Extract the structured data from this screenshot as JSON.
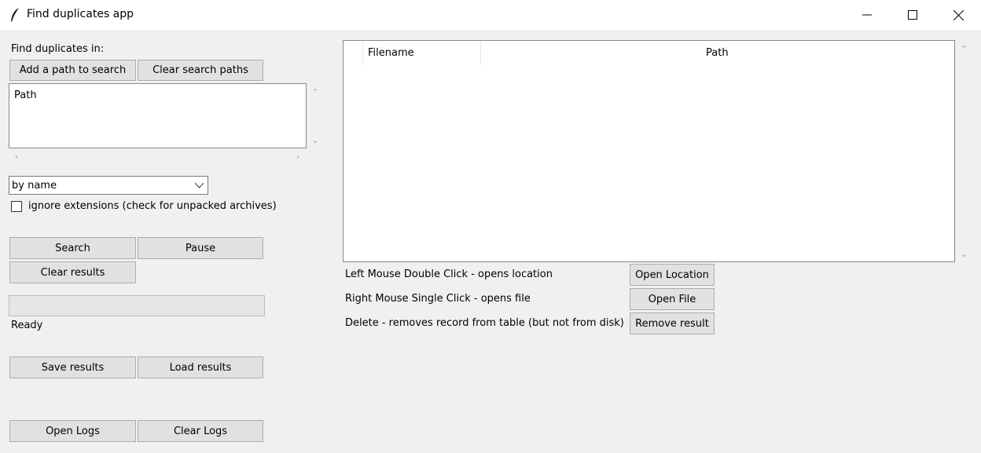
{
  "window": {
    "title": "Find duplicates app",
    "icons": [
      "feather-icon",
      "minimize-icon",
      "maximize-icon",
      "close-icon"
    ]
  },
  "left": {
    "find_in_label": "Find duplicates in:",
    "add_path_label": "Add a path to search",
    "clear_paths_label": "Clear search paths",
    "paths_list": [
      "Path"
    ],
    "mode_value": "by name",
    "ignore_ext_label": "ignore extensions (check for unpacked archives)",
    "ignore_ext_checked": false,
    "search_label": "Search",
    "pause_label": "Pause",
    "clear_results_label": "Clear results",
    "progress": 0,
    "status_text": "Ready",
    "save_results_label": "Save results",
    "load_results_label": "Load results",
    "open_logs_label": "Open Logs",
    "clear_logs_label": "Clear Logs"
  },
  "results": {
    "columns": [
      "Filename",
      "Path"
    ],
    "rows": []
  },
  "help": {
    "double_click_text": "Left Mouse Double Click - opens location",
    "right_click_text": "Right Mouse Single Click - opens file",
    "delete_text": "Delete - removes record from table (but not from disk)",
    "open_location_label": "Open Location",
    "open_file_label": "Open File",
    "remove_result_label": "Remove result"
  }
}
